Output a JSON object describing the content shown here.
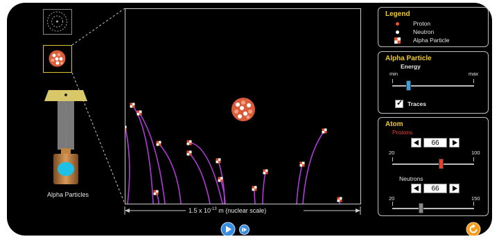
{
  "gun": {
    "label": "Alpha Particles"
  },
  "scale": {
    "label_prefix": "1.5 x 10",
    "label_exp": "-13",
    "label_suffix": " m (nuclear scale)"
  },
  "legend": {
    "title": "Legend",
    "items": [
      {
        "label": "Proton",
        "color": "#e8542e"
      },
      {
        "label": "Neutron",
        "color": "#ffffff"
      },
      {
        "label": "Alpha Particle",
        "color": "#e8542e"
      }
    ]
  },
  "alpha": {
    "title": "Alpha Particle",
    "energy_label": "Energy",
    "min_label": "min",
    "max_label": "max",
    "energy_fraction": 0.2,
    "traces_label": "Traces",
    "traces_checked": true
  },
  "atom": {
    "title": "Atom",
    "protons_label": "Protons",
    "protons_value": "66",
    "protons_min": "20",
    "protons_max": "100",
    "neutrons_label": "Neutrons",
    "neutrons_value": "66",
    "neutrons_min": "20",
    "neutrons_max": "150"
  },
  "colors": {
    "accent": "#f3cc2a",
    "trace": "#b23ad8",
    "protons_label": "#e8402a",
    "energy_knob": "#3aa0e0",
    "protons_knob": "#e8402a",
    "neutrons_knob": "#888888",
    "play_button": "#3a8ee0",
    "reset_button": "#f39c1e"
  }
}
